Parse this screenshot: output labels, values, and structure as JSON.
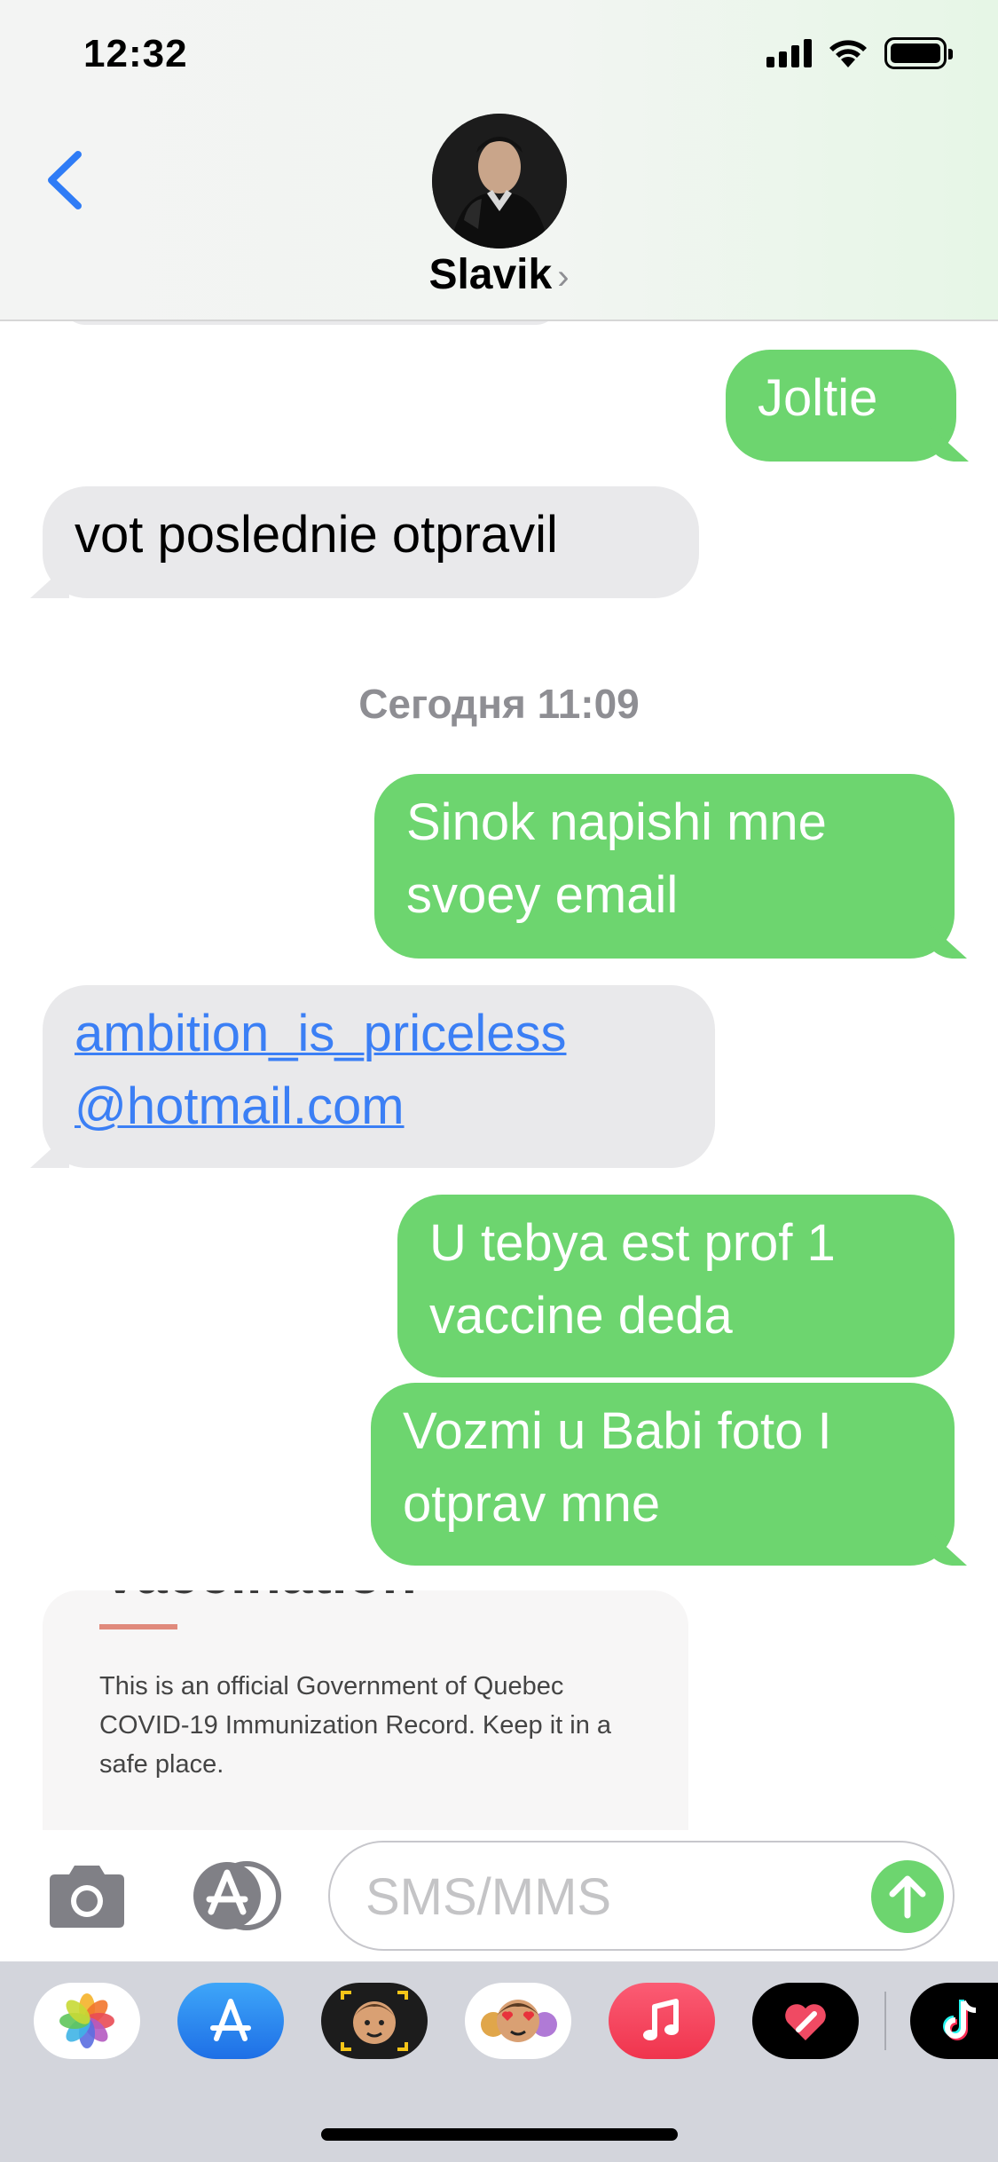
{
  "status_bar": {
    "time": "12:32"
  },
  "header": {
    "contact_name": "Slavik",
    "chevron": "›"
  },
  "messages": {
    "m1": "Joltie",
    "m2": "vot poslednie otpravil",
    "timestamp": "Сегодня 11:09",
    "m3_line1": "Sinok napishi mne",
    "m3_line2": "svoey email",
    "m4_line1": "ambition_is_priceless",
    "m4_line2": "@hotmail.com",
    "m5_line1": "U tebya est prof 1",
    "m5_line2": "vaccine deda",
    "m6_line1": "Vozmi u Babi foto I",
    "m6_line2": "otprav mne"
  },
  "attachment": {
    "heading": "Vaccination",
    "text_line1": "This is an official Government of Quebec",
    "text_line2": "COVID-19 Immunization Record. Keep it in a",
    "text_line3": "safe place."
  },
  "input": {
    "placeholder": "SMS/MMS"
  },
  "app_drawer": [
    {
      "name": "photos-app",
      "icon": "photos-icon"
    },
    {
      "name": "app-store",
      "icon": "app-store-icon"
    },
    {
      "name": "memoji-camera",
      "icon": "memoji-camera-icon"
    },
    {
      "name": "memoji-stickers",
      "icon": "memoji-stickers-icon"
    },
    {
      "name": "music",
      "icon": "music-icon"
    },
    {
      "name": "digital-touch",
      "icon": "heart-icon"
    },
    {
      "name": "tiktok",
      "icon": "tiktok-icon"
    }
  ],
  "colors": {
    "outgoing_bubble": "#6dd56f",
    "incoming_bubble": "#e9e9eb",
    "link": "#3b7ff5",
    "accent_blue": "#2f7cf6"
  }
}
